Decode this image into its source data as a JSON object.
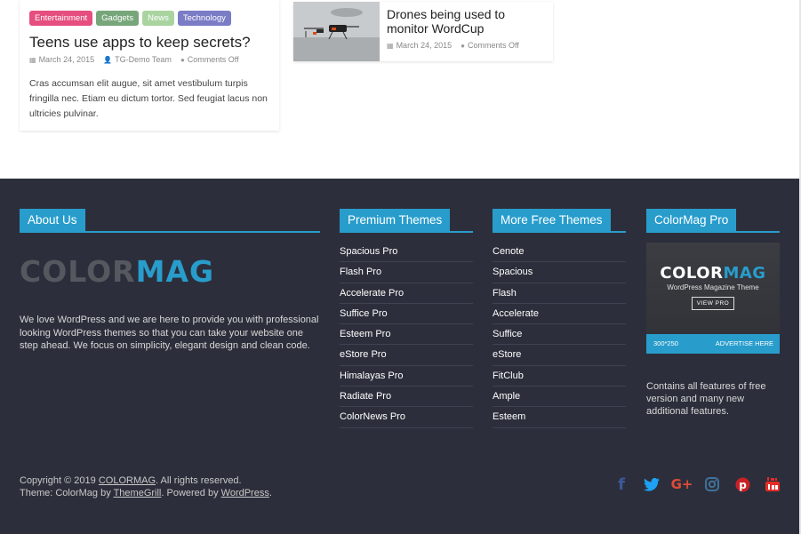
{
  "articles": {
    "primary": {
      "tags": [
        {
          "label": "Entertainment",
          "color": "#e54e7e"
        },
        {
          "label": "Gadgets",
          "color": "#77a67a"
        },
        {
          "label": "News",
          "color": "#a9d4a0"
        },
        {
          "label": "Technology",
          "color": "#7a7cc6"
        }
      ],
      "title": "Teens use apps to keep secrets?",
      "date": "March 24, 2015",
      "author": "TG-Demo Team",
      "comments": "Comments Off",
      "excerpt": "Cras accumsan elit augue, sit amet vestibulum turpis fringilla nec. Etiam eu dictum tortor. Sed feugiat lacus non ultricies pulvinar."
    },
    "secondary": {
      "title": "Drones being used to monitor WordCup",
      "date": "March 24, 2015",
      "comments": "Comments Off"
    }
  },
  "footer": {
    "about": {
      "heading": "About Us",
      "logo_part1": "COLOR",
      "logo_part2": "MAG",
      "text": "We love WordPress and we are here to provide you with professional looking WordPress themes so that you can take your website one step ahead. We focus on simplicity, elegant design and clean code."
    },
    "premium": {
      "heading": "Premium Themes",
      "items": [
        "Spacious Pro",
        "Flash Pro",
        "Accelerate Pro",
        "Suffice Pro",
        "Esteem Pro",
        "eStore Pro",
        "Himalayas Pro",
        "Radiate Pro",
        "ColorNews Pro"
      ]
    },
    "free": {
      "heading": "More Free Themes",
      "items": [
        "Cenote",
        "Spacious",
        "Flash",
        "Accelerate",
        "Suffice",
        "eStore",
        "FitClub",
        "Ample",
        "Esteem"
      ]
    },
    "pro": {
      "heading": "ColorMag Pro",
      "ad_logo_part1": "COLOR",
      "ad_logo_part2": "MAG",
      "ad_subtitle": "WordPress Magazine Theme",
      "ad_button": "VIEW PRO",
      "ad_size": "300*250",
      "ad_advertise": "ADVERTISE HERE",
      "text": "Contains all features of free version and many new additional features."
    },
    "copyright": {
      "prefix": "Copyright © 2019 ",
      "site": "COLORMAG",
      "suffix": ". All rights reserved.",
      "theme_prefix": "Theme: ColorMag by ",
      "themegrill": "ThemeGrill",
      "powered": ". Powered by ",
      "wordpress": "WordPress",
      "end": "."
    },
    "social": [
      {
        "icon": "facebook-icon",
        "glyph": "f",
        "color": "#3b5998"
      },
      {
        "icon": "twitter-icon",
        "glyph": "🐦",
        "color": "#1da1f2"
      },
      {
        "icon": "google-plus-icon",
        "glyph": "G+",
        "color": "#dd4b39"
      },
      {
        "icon": "instagram-icon",
        "glyph": "◎",
        "color": "#3f729b"
      },
      {
        "icon": "pinterest-icon",
        "glyph": "℗",
        "color": "#cb2027"
      },
      {
        "icon": "youtube-icon",
        "glyph": "▶",
        "color": "#e52d27"
      }
    ],
    "accent_color": "#289dcc",
    "background_color": "#2c2f3b"
  }
}
